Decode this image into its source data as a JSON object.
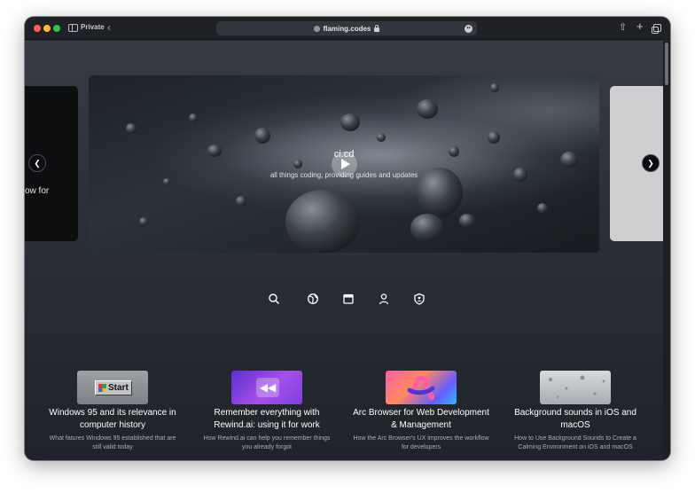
{
  "browser": {
    "private_label": "Private",
    "url": "flaming.codes",
    "back_icon": "chevron-left-icon",
    "share_icon": "share-icon",
    "new_tab_icon": "plus-icon",
    "tabs_icon": "tabs-overview-icon"
  },
  "carousel": {
    "prev_card_text": "ow for",
    "hero": {
      "title": "ci.cd",
      "subtitle": "all things coding, providing guides and updates"
    },
    "prev_icon": "chevron-left-icon",
    "next_icon": "chevron-right-icon"
  },
  "icon_row": [
    "search-icon",
    "globe-icon",
    "calendar-icon",
    "user-icon",
    "shield-icon"
  ],
  "articles": [
    {
      "title": "Windows 95 and its relevance in computer history",
      "description": "What fatures Windows 95 established that are still valid today",
      "thumb_text": "Start"
    },
    {
      "title": "Remember everything with Rewind.ai: using it for work",
      "description": "How Rewind.ai can help you remember things you already forgot",
      "thumb_text": "◀◀"
    },
    {
      "title": "Arc Browser for Web Development & Management",
      "description": "How the Arc Browser's UX improves the workflow for developers"
    },
    {
      "title": "Background sounds in iOS and macOS",
      "description": "How to Use Background Sounds to Create a Calming Environment on iOS and macOS"
    }
  ],
  "colors": {
    "page_background": "#2b2f37",
    "window_chrome": "#1f2126",
    "text_primary": "#ffffff",
    "text_secondary": "#a9aeb6"
  }
}
